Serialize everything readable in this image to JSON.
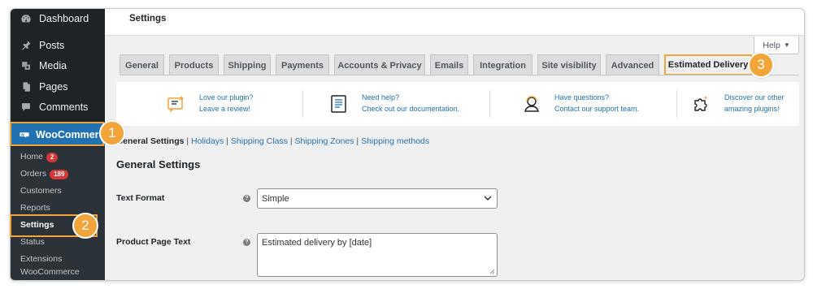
{
  "sidebar": {
    "items": [
      {
        "label": "Dashboard",
        "icon": "dashboard-icon"
      },
      {
        "label": "Posts",
        "icon": "pin-icon"
      },
      {
        "label": "Media",
        "icon": "media-icon"
      },
      {
        "label": "Pages",
        "icon": "pages-icon"
      },
      {
        "label": "Comments",
        "icon": "comments-icon"
      }
    ],
    "woocommerce": {
      "label": "WooCommerce",
      "icon": "woocommerce-icon",
      "highlight_color": "#f0a43a"
    },
    "submenu": [
      {
        "label": "Home",
        "badge": "2"
      },
      {
        "label": "Orders",
        "badge": "189"
      },
      {
        "label": "Customers"
      },
      {
        "label": "Reports"
      },
      {
        "label": "Settings",
        "active": true
      },
      {
        "label": "Status"
      },
      {
        "label": "Extensions"
      },
      {
        "label": "WooCommerce"
      }
    ]
  },
  "header": {
    "title": "Settings",
    "help_label": "Help"
  },
  "tabs": [
    {
      "label": "General"
    },
    {
      "label": "Products"
    },
    {
      "label": "Shipping"
    },
    {
      "label": "Payments"
    },
    {
      "label": "Accounts & Privacy"
    },
    {
      "label": "Emails"
    },
    {
      "label": "Integration"
    },
    {
      "label": "Site visibility"
    },
    {
      "label": "Advanced"
    },
    {
      "label": "Estimated Delivery",
      "active": true
    }
  ],
  "promo": [
    {
      "line1": "Love our plugin?",
      "line2": "Leave a review!",
      "icon": "review-icon"
    },
    {
      "line1": "Need help?",
      "line2": "Check out our documentation.",
      "icon": "documentation-icon"
    },
    {
      "line1": "Have questions?",
      "line2": "Contact our support team.",
      "icon": "support-icon"
    },
    {
      "line1": "Discover our other",
      "line2": "amazing plugins!",
      "icon": "puzzle-icon"
    }
  ],
  "subnav": {
    "current": "General Settings",
    "links": [
      "Holidays",
      "Shipping Class",
      "Shipping Zones",
      "Shipping methods"
    ]
  },
  "form": {
    "section_title": "General Settings",
    "text_format": {
      "label": "Text Format",
      "value": "Simple"
    },
    "product_page_text": {
      "label": "Product Page Text",
      "value": "Estimated delivery by [date]"
    }
  },
  "callouts": [
    "1",
    "2",
    "3"
  ],
  "colors": {
    "accent": "#f0a43a",
    "link": "#2271b1",
    "sidebar": "#1d2327",
    "badge": "#d63638"
  }
}
